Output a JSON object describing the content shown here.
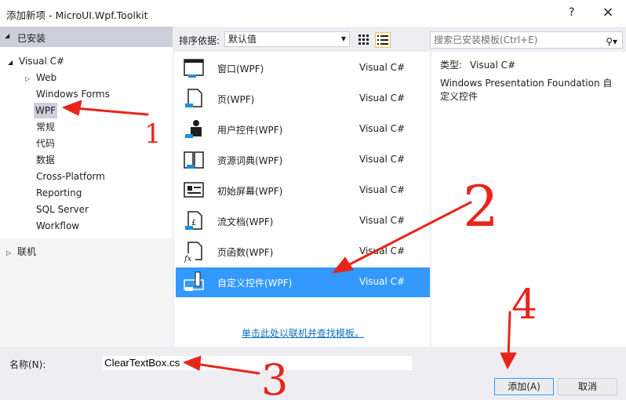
{
  "window": {
    "title": "添加新项 - MicroUI.Wpf.Toolkit",
    "help_label": "?",
    "close_label": "×"
  },
  "left": {
    "installed_label": "已安装",
    "tree": [
      {
        "label": "Visual C#",
        "arrow": "◢"
      },
      {
        "label": "Web",
        "arrow": "▷"
      },
      {
        "label": "Windows Forms"
      },
      {
        "label": "WPF",
        "selected": true
      },
      {
        "label": "常规"
      },
      {
        "label": "代码"
      },
      {
        "label": "数据"
      },
      {
        "label": "Cross-Platform"
      },
      {
        "label": "Reporting"
      },
      {
        "label": "SQL Server"
      },
      {
        "label": "Workflow"
      }
    ],
    "online_label": "联机"
  },
  "toolbar": {
    "sort_label": "排序依据:",
    "sort_value": "默认值",
    "search_placeholder": "搜索已安装模板(Ctrl+E)"
  },
  "templates": [
    {
      "name": "窗口(WPF)",
      "lang": "Visual C#",
      "icon": "window-icon"
    },
    {
      "name": "页(WPF)",
      "lang": "Visual C#",
      "icon": "page-icon"
    },
    {
      "name": "用户控件(WPF)",
      "lang": "Visual C#",
      "icon": "user-control-icon"
    },
    {
      "name": "资源词典(WPF)",
      "lang": "Visual C#",
      "icon": "resource-dictionary-icon"
    },
    {
      "name": "初始屏幕(WPF)",
      "lang": "Visual C#",
      "icon": "splash-screen-icon"
    },
    {
      "name": "流文档(WPF)",
      "lang": "Visual C#",
      "icon": "flow-document-icon"
    },
    {
      "name": "页函数(WPF)",
      "lang": "Visual C#",
      "icon": "page-function-icon"
    },
    {
      "name": "自定义控件(WPF)",
      "lang": "Visual C#",
      "icon": "custom-control-icon",
      "selected": true
    }
  ],
  "online_link": "单击此处以联机并查找模板。",
  "info": {
    "type_label": "类型:",
    "type_value": "Visual C#",
    "description": "Windows Presentation Foundation 自定义控件"
  },
  "bottom": {
    "name_label": "名称(N):",
    "name_value": "ClearTextBox.cs",
    "add_label": "添加(A)",
    "cancel_label": "取消"
  },
  "annotations": [
    "1",
    "2",
    "3",
    "4"
  ],
  "colors": {
    "selection": "#3399ff",
    "annotation": "#e8251c",
    "tree_selection": "#cccedb",
    "link": "#0e70c0"
  }
}
